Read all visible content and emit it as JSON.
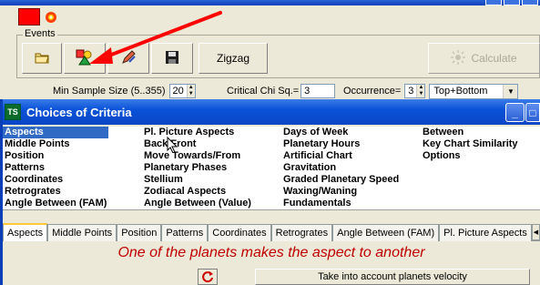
{
  "main": {
    "events_label": "Events",
    "zigzag_label": "Zigzag",
    "calculate_label": "Calculate",
    "min_sample_label": "Min Sample Size (5..355)",
    "min_sample_value": "20",
    "critical_chi_label": "Critical Chi Sq.=",
    "critical_chi_value": "3",
    "occurrence_label": "Occurrence=",
    "occurrence_value": "3",
    "occurrence_mode": "Top+Bottom"
  },
  "dialog": {
    "logo_text": "TS",
    "title": "Choices of Criteria",
    "minimize": "_",
    "maximize": "□",
    "columns": [
      [
        "Aspects",
        "Middle Points",
        "Position",
        "Patterns",
        "Coordinates",
        "Retrogrates",
        "Angle Between (FAM)"
      ],
      [
        "Pl. Picture Aspects",
        "Back/Front",
        "Move Towards/From",
        "Planetary Phases",
        "Stellium",
        "Zodiacal Aspects",
        "Angle Between (Value)"
      ],
      [
        "Days of Week",
        "Planetary Hours",
        "Artificial Chart",
        "Gravitation",
        "Graded Planetary Speed",
        "Waxing/Waning",
        "Fundamentals"
      ],
      [
        "Between",
        "Key Chart Similarity",
        "Options"
      ]
    ],
    "tabs": [
      "Aspects",
      "Middle Points",
      "Position",
      "Patterns",
      "Coordinates",
      "Retrogrates",
      "Angle Between (FAM)",
      "Pl. Picture Aspects"
    ],
    "description": "One of the planets makes  the aspect to another",
    "velocity_label": "Take into account planets velocity"
  },
  "colors": {
    "selection": "#316ac5",
    "description_text": "#c00000",
    "arrow": "#ff0000"
  }
}
